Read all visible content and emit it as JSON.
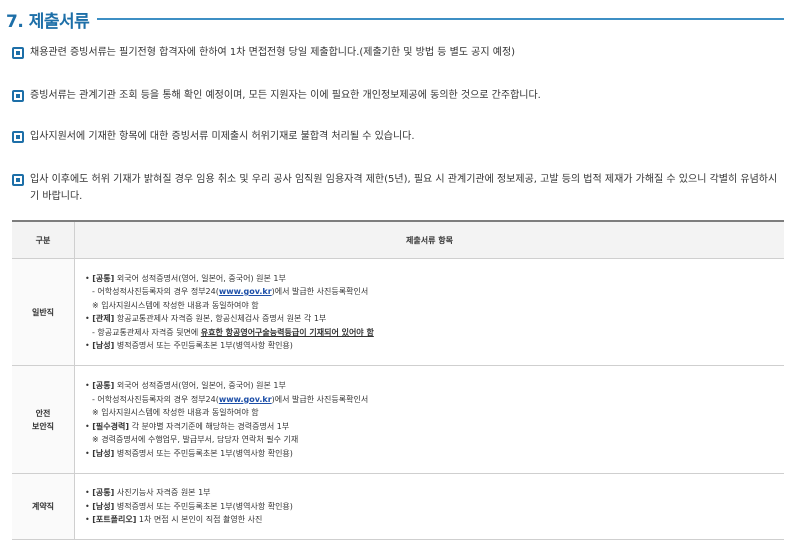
{
  "section": {
    "title": "7. 제출서류"
  },
  "notes": [
    "채용관련 증빙서류는 필기전형 합격자에 한하여 1차 면접전형 당일 제출합니다.(제출기한 및 방법 등 별도 공지 예정)",
    "증빙서류는 관계기관 조회 등을 통해 확인 예정이며, 모든 지원자는 이에 필요한 개인정보제공에 동의한 것으로 간주합니다.",
    "입사지원서에 기재한 항목에 대한 증빙서류 미제출시 허위기재로 불합격 처리될 수 있습니다.",
    "입사 이후에도 허위 기재가 밝혀질 경우 임용 취소 및 우리 공사 임직원 임용자격 제한(5년), 필요 시 관계기관에 정보제공, 고발 등의 법적 제재가 가해질 수 있으니 각별히 유념하시기 바랍니다."
  ],
  "table": {
    "headers": [
      "구분",
      "제출서류 항목"
    ],
    "row1": {
      "type": "일반직",
      "l1_bullet": "•",
      "l1_tag": "[공통]",
      "l1_text": " 외국어 성적증명서(영어, 일본어, 중국어) 원본 1부",
      "l2_pre": "- 어학성적사진등록자의 경우 정부24(",
      "l2_link": "www.gov.kr",
      "l2_post": ")에서 발급한 사진등록확인서",
      "l3": "※ 입사지원시스템에 작성한 내용과 동일하여야 함",
      "l4_bullet": "•",
      "l4_tag": "[관제]",
      "l4_text": " 항공교통관제사 자격증 원본, 항공신체검사 증명서 원본 각 1부",
      "l5_pre": "- 항공교통관제사 자격증 뒷면에 ",
      "l5_u": "유효한 항공영어구술능력등급이 기재되어 있어야 함",
      "l6_bullet": "•",
      "l6_tag": "[남성]",
      "l6_text": " 병적증명서 또는 주민등록초본 1부(병역사항 확인용)"
    },
    "row2": {
      "type_l1": "안전",
      "type_l2": "보안직",
      "l1_bullet": "•",
      "l1_tag": "[공통]",
      "l1_text": " 외국어 성적증명서(영어, 일본어, 중국어) 원본 1부",
      "l2_pre": "- 어학성적사진등록자의 경우 정부24(",
      "l2_link": "www.gov.kr",
      "l2_post": ")에서 발급한 사진등록확인서",
      "l3": "※ 입사지원시스템에 작성한 내용과 동일하여야 함",
      "l4_bullet": "•",
      "l4_tag": "[필수경력]",
      "l4_text": " 각 분야별 자격기준에 해당하는 경력증명서 1부",
      "l5": "※ 경력증명서에 수행업무, 발급부서, 담당자 연락처 필수 기재",
      "l6_bullet": "•",
      "l6_tag": "[남성]",
      "l6_text": " 병적증명서 또는 주민등록초본 1부(병역사항 확인용)"
    },
    "row3": {
      "type": "계약직",
      "l1_bullet": "•",
      "l1_tag": "[공통]",
      "l1_text": " 사진기능사 자격증 원본 1부",
      "l2_bullet": "•",
      "l2_tag": "[남성]",
      "l2_text": " 병적증명서 또는 주민등록초본 1부(병역사항 확인용)",
      "l3_bullet": "•",
      "l3_tag": "[포트폴리오]",
      "l3_text": " 1차 면접 시 본인이 직접 촬영한 사진"
    }
  }
}
